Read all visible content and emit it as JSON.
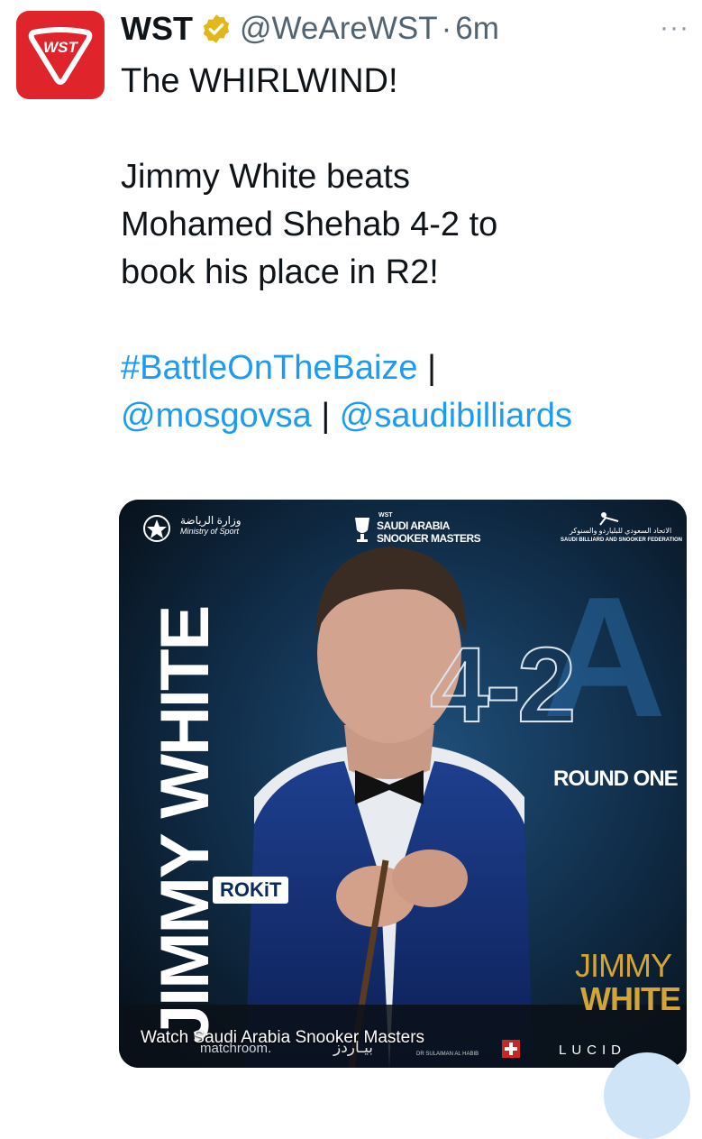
{
  "tweet": {
    "author_name": "WST",
    "handle": "@WeAreWST",
    "separator": "·",
    "time": "6m",
    "more": "···",
    "avatar_logo": "WST",
    "line1": "The WHIRLWIND!",
    "line2": "Jimmy White beats",
    "line3": "Mohamed Shehab 4-2 to",
    "line4": "book his place in R2!",
    "hashtag": "#BattleOnTheBaize",
    "pipe1": " |",
    "mention1": "@mosgovsa",
    "pipe2": " | ",
    "mention2": "@saudibilliards"
  },
  "media": {
    "ministry_ar": "وزارة الرياضة",
    "ministry_en": "Ministry of Sport",
    "event_tag": "WST",
    "event_line1": "SAUDI ARABIA",
    "event_line2": "SNOOKER MASTERS",
    "federation_ar": "الاتحاد السعودي للبلياردو والسنوكر",
    "federation_en": "SAUDI BILLIARD AND SNOOKER FEDERATION",
    "vertical_name": "JIMMY WHITE",
    "score": "4-2",
    "round": "ROUND ONE",
    "player_first": "JIMMY",
    "player_last": "WHITE",
    "sponsor_rokit": "ROKiT",
    "watch_caption": "Watch Saudi Arabia Snooker Masters",
    "sponsor_matchroom": "matchroom.",
    "sponsor_arabic": "بيـاردز",
    "sponsor_drs": "DR SULAIMAN AL HABIB",
    "sponsor_lucid": "LUCID"
  },
  "colors": {
    "avatar_red": "#e0242c",
    "link_blue": "#1d9bf0",
    "verified_gold": "#e2b719",
    "handle_gray": "#536471",
    "gold_text": "#d4a534",
    "media_bg": "#0a1622"
  }
}
